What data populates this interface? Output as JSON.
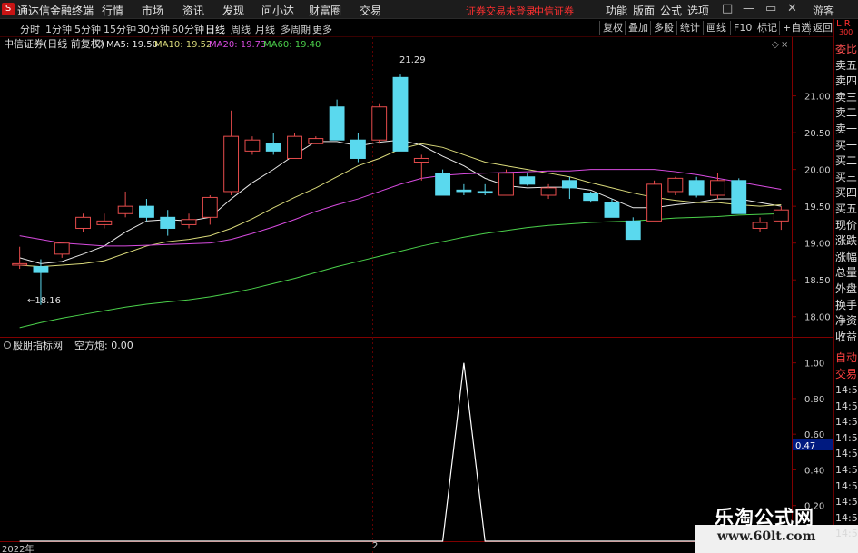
{
  "menubar": {
    "logo": "S",
    "app_title": "通达信金融终端",
    "items": [
      "行情",
      "市场",
      "资讯",
      "发现",
      "问小达",
      "财富圈",
      "交易"
    ],
    "warning": "证券交易未登录",
    "broker": "中信证券",
    "right_items": [
      "功能",
      "版面",
      "公式",
      "选项"
    ],
    "guest": "游客",
    "window_buttons": [
      "□",
      "—",
      "▭",
      "✕"
    ]
  },
  "periodbar": {
    "periods": [
      "分时",
      "1分钟",
      "5分钟",
      "15分钟",
      "30分钟",
      "60分钟",
      "日线",
      "周线",
      "月线",
      "多周期",
      "更多"
    ],
    "active": "日线",
    "tools": [
      "复权",
      "叠加",
      "多股",
      "统计",
      "画线",
      "F10",
      "标记",
      "+自选",
      "返回"
    ]
  },
  "main": {
    "stock": "中信证券(日线 前复权)",
    "ma5_label": "MA5: 19.50",
    "ma10_label": "MA10: 19.52",
    "ma20_label": "MA20: 19.73",
    "ma60_label": "MA60: 19.40",
    "high_label": "21.29",
    "low_label": "←18.16",
    "price_axis": [
      "21.00",
      "20.50",
      "20.00",
      "19.50",
      "19.00",
      "18.50",
      "18.00"
    ]
  },
  "indicator": {
    "name": "股朋指标网",
    "value_label": "空方炮: 0.00",
    "axis": [
      "1.00",
      "0.80",
      "0.60",
      "0.40",
      "0.20"
    ],
    "current": "0.47"
  },
  "side_panel": {
    "lr": "L R",
    "lr_sub": "300",
    "labels": [
      "委比",
      "卖五",
      "卖四",
      "卖三",
      "卖二",
      "卖一",
      "买一",
      "买二",
      "买三",
      "买四",
      "买五",
      "现价",
      "涨跌",
      "涨幅",
      "总量",
      "外盘",
      "换手",
      "净资",
      "收益"
    ],
    "lower": [
      "自动",
      "交易"
    ],
    "times": [
      "14:56",
      "14:56",
      "14:56",
      "14:56",
      "14:56",
      "14:56",
      "14:56",
      "14:56",
      "14:56",
      "14:56"
    ]
  },
  "xaxis": {
    "year": "2022年",
    "tick": "2"
  },
  "watermark": {
    "title": "乐淘公式网",
    "url": "www.60lt.com"
  },
  "colors": {
    "up": "#e74c4c",
    "down": "#5ad9ee",
    "ma5": "#e8e8e8",
    "ma10": "#d9d97a",
    "ma20": "#d84be0",
    "ma60": "#4bd14b",
    "axis_border": "#800000",
    "indicator_line": "#ffffff"
  },
  "chart_data": [
    {
      "type": "candlestick",
      "title": "中信证券(日线 前复权)",
      "ylim": [
        17.75,
        21.55
      ],
      "candles": [
        {
          "o": 18.7,
          "h": 18.95,
          "l": 18.65,
          "c": 18.72
        },
        {
          "o": 18.68,
          "h": 18.78,
          "l": 18.16,
          "c": 18.6
        },
        {
          "o": 18.85,
          "h": 19.0,
          "l": 18.8,
          "c": 19.0
        },
        {
          "o": 19.2,
          "h": 19.4,
          "l": 19.15,
          "c": 19.35
        },
        {
          "o": 19.25,
          "h": 19.4,
          "l": 19.2,
          "c": 19.3
        },
        {
          "o": 19.4,
          "h": 19.7,
          "l": 19.35,
          "c": 19.5
        },
        {
          "o": 19.5,
          "h": 19.6,
          "l": 19.3,
          "c": 19.35
        },
        {
          "o": 19.35,
          "h": 19.45,
          "l": 19.1,
          "c": 19.2
        },
        {
          "o": 19.25,
          "h": 19.4,
          "l": 19.2,
          "c": 19.32
        },
        {
          "o": 19.35,
          "h": 19.65,
          "l": 19.25,
          "c": 19.62
        },
        {
          "o": 19.7,
          "h": 20.8,
          "l": 19.65,
          "c": 20.45
        },
        {
          "o": 20.25,
          "h": 20.45,
          "l": 20.2,
          "c": 20.4
        },
        {
          "o": 20.35,
          "h": 20.5,
          "l": 20.2,
          "c": 20.25
        },
        {
          "o": 20.15,
          "h": 20.5,
          "l": 20.15,
          "c": 20.45
        },
        {
          "o": 20.35,
          "h": 20.45,
          "l": 20.35,
          "c": 20.42
        },
        {
          "o": 20.85,
          "h": 20.95,
          "l": 20.4,
          "c": 20.4
        },
        {
          "o": 20.4,
          "h": 20.5,
          "l": 20.1,
          "c": 20.15
        },
        {
          "o": 20.4,
          "h": 20.9,
          "l": 20.35,
          "c": 20.85
        },
        {
          "o": 21.25,
          "h": 21.29,
          "l": 20.25,
          "c": 20.25
        },
        {
          "o": 20.1,
          "h": 20.2,
          "l": 19.85,
          "c": 20.15
        },
        {
          "o": 19.95,
          "h": 20.0,
          "l": 19.65,
          "c": 19.65
        },
        {
          "o": 19.72,
          "h": 19.8,
          "l": 19.65,
          "c": 19.7
        },
        {
          "o": 19.7,
          "h": 19.8,
          "l": 19.65,
          "c": 19.68
        },
        {
          "o": 19.65,
          "h": 20.0,
          "l": 19.65,
          "c": 19.95
        },
        {
          "o": 19.9,
          "h": 19.95,
          "l": 19.78,
          "c": 19.8
        },
        {
          "o": 19.65,
          "h": 19.8,
          "l": 19.6,
          "c": 19.75
        },
        {
          "o": 19.85,
          "h": 19.9,
          "l": 19.6,
          "c": 19.75
        },
        {
          "o": 19.68,
          "h": 19.7,
          "l": 19.55,
          "c": 19.58
        },
        {
          "o": 19.55,
          "h": 19.6,
          "l": 19.35,
          "c": 19.35
        },
        {
          "o": 19.3,
          "h": 19.35,
          "l": 19.05,
          "c": 19.05
        },
        {
          "o": 19.3,
          "h": 19.85,
          "l": 19.3,
          "c": 19.8
        },
        {
          "o": 19.7,
          "h": 19.9,
          "l": 19.65,
          "c": 19.88
        },
        {
          "o": 19.85,
          "h": 19.9,
          "l": 19.62,
          "c": 19.65
        },
        {
          "o": 19.65,
          "h": 19.95,
          "l": 19.6,
          "c": 19.85
        },
        {
          "o": 19.85,
          "h": 19.88,
          "l": 19.4,
          "c": 19.4
        },
        {
          "o": 19.2,
          "h": 19.35,
          "l": 19.15,
          "c": 19.28
        },
        {
          "o": 19.3,
          "h": 19.5,
          "l": 19.18,
          "c": 19.45
        }
      ],
      "series": [
        {
          "name": "MA5",
          "values": [
            18.8,
            18.72,
            18.75,
            18.85,
            18.96,
            19.15,
            19.3,
            19.32,
            19.3,
            19.35,
            19.6,
            19.82,
            20.0,
            20.2,
            20.38,
            20.38,
            20.32,
            20.37,
            20.4,
            20.33,
            20.18,
            20.05,
            19.88,
            19.78,
            19.75,
            19.76,
            19.76,
            19.72,
            19.6,
            19.48,
            19.48,
            19.52,
            19.55,
            19.6,
            19.6,
            19.55,
            19.5
          ]
        },
        {
          "name": "MA10",
          "values": [
            18.7,
            18.68,
            18.7,
            18.72,
            18.76,
            18.86,
            18.96,
            19.02,
            19.05,
            19.1,
            19.2,
            19.33,
            19.48,
            19.62,
            19.75,
            19.9,
            20.05,
            20.15,
            20.28,
            20.35,
            20.3,
            20.2,
            20.1,
            20.05,
            20.0,
            19.95,
            19.9,
            19.82,
            19.75,
            19.68,
            19.62,
            19.58,
            19.55,
            19.55,
            19.52,
            19.5,
            19.52
          ]
        },
        {
          "name": "MA20",
          "values": [
            19.1,
            19.05,
            19.0,
            18.98,
            18.96,
            18.96,
            18.97,
            18.98,
            18.99,
            19.0,
            19.05,
            19.13,
            19.22,
            19.32,
            19.43,
            19.52,
            19.6,
            19.7,
            19.8,
            19.88,
            19.92,
            19.94,
            19.95,
            19.96,
            19.97,
            19.98,
            19.98,
            20.0,
            20.0,
            20.0,
            20.0,
            19.97,
            19.93,
            19.88,
            19.83,
            19.78,
            19.73
          ]
        },
        {
          "name": "MA60",
          "values": [
            17.85,
            17.92,
            17.98,
            18.03,
            18.08,
            18.13,
            18.17,
            18.2,
            18.23,
            18.27,
            18.32,
            18.38,
            18.45,
            18.52,
            18.6,
            18.68,
            18.75,
            18.82,
            18.89,
            18.96,
            19.02,
            19.08,
            19.13,
            19.17,
            19.21,
            19.24,
            19.26,
            19.28,
            19.29,
            19.3,
            19.32,
            19.34,
            19.35,
            19.36,
            19.38,
            19.39,
            19.4
          ]
        }
      ]
    },
    {
      "type": "line",
      "title": "股朋指标网",
      "ylim": [
        0,
        1.1
      ],
      "series": [
        {
          "name": "空方炮",
          "values": [
            0,
            0,
            0,
            0,
            0,
            0,
            0,
            0,
            0,
            0,
            0,
            0,
            0,
            0,
            0,
            0,
            0,
            0,
            0,
            0,
            0,
            1,
            0,
            0,
            0,
            0,
            0,
            0,
            0,
            0,
            0,
            0,
            0,
            0,
            0,
            0,
            0
          ]
        }
      ]
    }
  ]
}
